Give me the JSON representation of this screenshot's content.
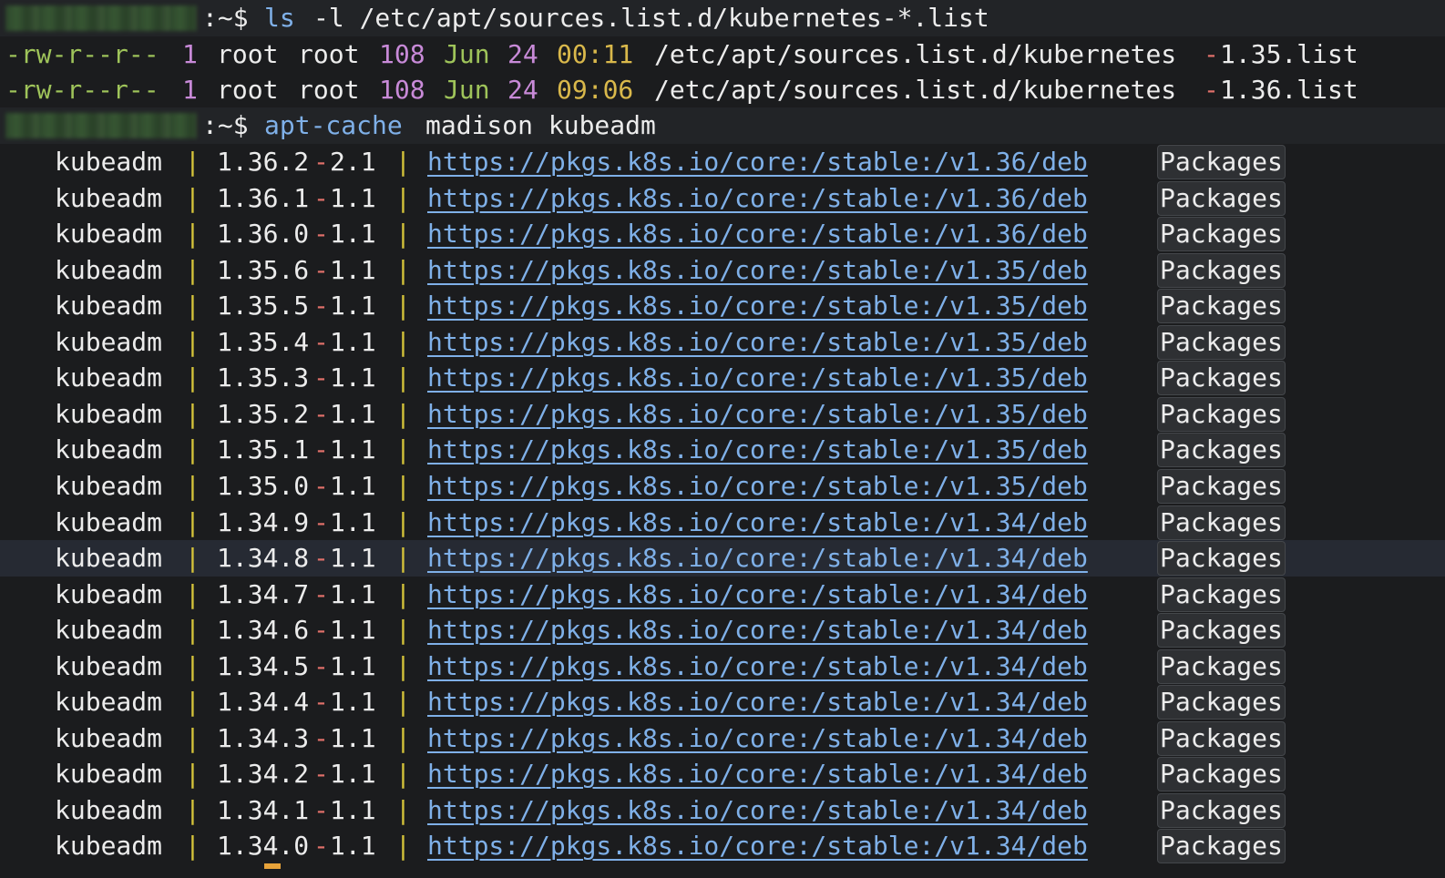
{
  "prompt": {
    "suffix": ":~$"
  },
  "cmd1": {
    "command": "ls",
    "args": "-l /etc/apt/sources.list.d/kubernetes-*.list"
  },
  "ls_output": [
    {
      "perms": "-rw-r--r--",
      "links": "1",
      "owner": "root",
      "group": "root",
      "size": "108",
      "month": "Jun",
      "day": "24",
      "time": "00:11",
      "path_prefix": "/etc/apt/sources.list.d/kubernetes",
      "path_dash": "-",
      "path_suffix": "1.35.list"
    },
    {
      "perms": "-rw-r--r--",
      "links": "1",
      "owner": "root",
      "group": "root",
      "size": "108",
      "month": "Jun",
      "day": "24",
      "time": "09:06",
      "path_prefix": "/etc/apt/sources.list.d/kubernetes",
      "path_dash": "-",
      "path_suffix": "1.36.list"
    }
  ],
  "cmd2": {
    "command": "apt-cache",
    "args": "madison kubeadm"
  },
  "pipe": "|",
  "packages_label": "Packages",
  "madison_rows": [
    {
      "pkg": "kubeadm",
      "v_major": "1.36.2",
      "v_rev": "2.1",
      "url": "https://pkgs.k8s.io/core:/stable:/v1.36/deb"
    },
    {
      "pkg": "kubeadm",
      "v_major": "1.36.1",
      "v_rev": "1.1",
      "url": "https://pkgs.k8s.io/core:/stable:/v1.36/deb"
    },
    {
      "pkg": "kubeadm",
      "v_major": "1.36.0",
      "v_rev": "1.1",
      "url": "https://pkgs.k8s.io/core:/stable:/v1.36/deb"
    },
    {
      "pkg": "kubeadm",
      "v_major": "1.35.6",
      "v_rev": "1.1",
      "url": "https://pkgs.k8s.io/core:/stable:/v1.35/deb"
    },
    {
      "pkg": "kubeadm",
      "v_major": "1.35.5",
      "v_rev": "1.1",
      "url": "https://pkgs.k8s.io/core:/stable:/v1.35/deb"
    },
    {
      "pkg": "kubeadm",
      "v_major": "1.35.4",
      "v_rev": "1.1",
      "url": "https://pkgs.k8s.io/core:/stable:/v1.35/deb"
    },
    {
      "pkg": "kubeadm",
      "v_major": "1.35.3",
      "v_rev": "1.1",
      "url": "https://pkgs.k8s.io/core:/stable:/v1.35/deb"
    },
    {
      "pkg": "kubeadm",
      "v_major": "1.35.2",
      "v_rev": "1.1",
      "url": "https://pkgs.k8s.io/core:/stable:/v1.35/deb"
    },
    {
      "pkg": "kubeadm",
      "v_major": "1.35.1",
      "v_rev": "1.1",
      "url": "https://pkgs.k8s.io/core:/stable:/v1.35/deb"
    },
    {
      "pkg": "kubeadm",
      "v_major": "1.35.0",
      "v_rev": "1.1",
      "url": "https://pkgs.k8s.io/core:/stable:/v1.35/deb"
    },
    {
      "pkg": "kubeadm",
      "v_major": "1.34.9",
      "v_rev": "1.1",
      "url": "https://pkgs.k8s.io/core:/stable:/v1.34/deb"
    },
    {
      "pkg": "kubeadm",
      "v_major": "1.34.8",
      "v_rev": "1.1",
      "url": "https://pkgs.k8s.io/core:/stable:/v1.34/deb"
    },
    {
      "pkg": "kubeadm",
      "v_major": "1.34.7",
      "v_rev": "1.1",
      "url": "https://pkgs.k8s.io/core:/stable:/v1.34/deb"
    },
    {
      "pkg": "kubeadm",
      "v_major": "1.34.6",
      "v_rev": "1.1",
      "url": "https://pkgs.k8s.io/core:/stable:/v1.34/deb"
    },
    {
      "pkg": "kubeadm",
      "v_major": "1.34.5",
      "v_rev": "1.1",
      "url": "https://pkgs.k8s.io/core:/stable:/v1.34/deb"
    },
    {
      "pkg": "kubeadm",
      "v_major": "1.34.4",
      "v_rev": "1.1",
      "url": "https://pkgs.k8s.io/core:/stable:/v1.34/deb"
    },
    {
      "pkg": "kubeadm",
      "v_major": "1.34.3",
      "v_rev": "1.1",
      "url": "https://pkgs.k8s.io/core:/stable:/v1.34/deb"
    },
    {
      "pkg": "kubeadm",
      "v_major": "1.34.2",
      "v_rev": "1.1",
      "url": "https://pkgs.k8s.io/core:/stable:/v1.34/deb"
    },
    {
      "pkg": "kubeadm",
      "v_major": "1.34.1",
      "v_rev": "1.1",
      "url": "https://pkgs.k8s.io/core:/stable:/v1.34/deb"
    },
    {
      "pkg": "kubeadm",
      "v_major": "1.34.0",
      "v_rev": "1.1",
      "url": "https://pkgs.k8s.io/core:/stable:/v1.34/deb"
    }
  ],
  "colors": {
    "background": "#1b1c1e",
    "prompt_symbol": "#e0706a",
    "command": "#7fb0e8",
    "permissions": "#9fc45a",
    "number": "#c88ad8",
    "date": "#9fc45a",
    "time": "#d9b84b",
    "pipe": "#d4c23a",
    "url": "#7fb0e8",
    "cursor": "#e8a33a"
  }
}
